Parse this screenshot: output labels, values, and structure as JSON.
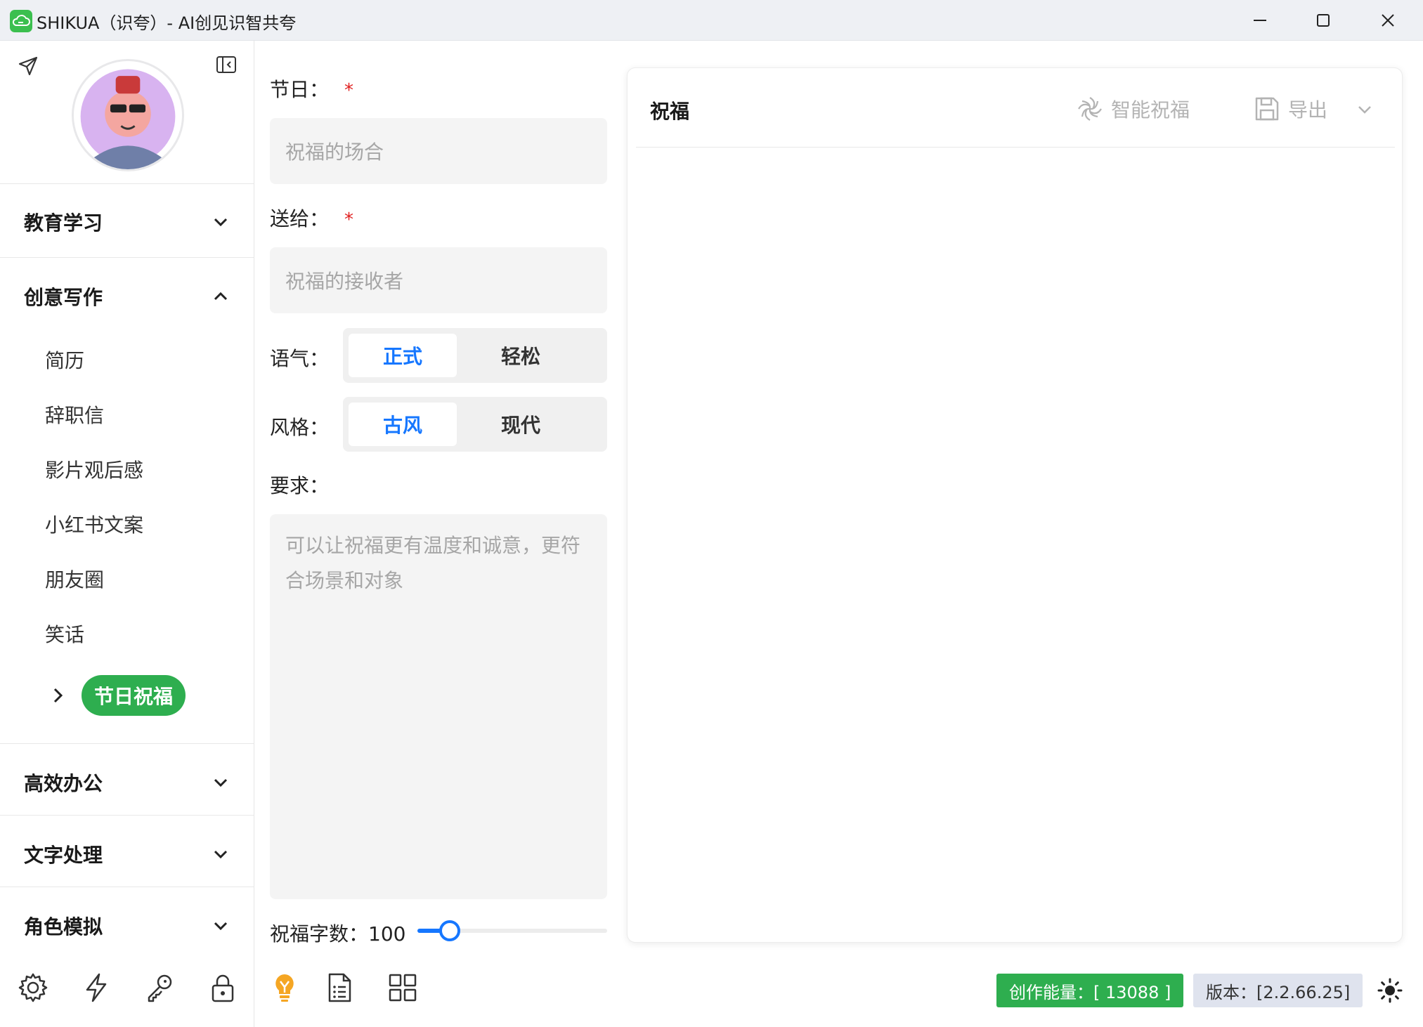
{
  "window": {
    "title": "SHIKUA（识夸）- AI创见识智共夸",
    "icons": {
      "app": "cloud-logo-icon",
      "minimize": "minimize-icon",
      "maximize": "maximize-icon",
      "close": "close-icon"
    }
  },
  "sidebar": {
    "categories": [
      {
        "label": "教育学习",
        "expanded": false
      },
      {
        "label": "创意写作",
        "expanded": true
      },
      {
        "label": "高效办公",
        "expanded": false
      },
      {
        "label": "文字处理",
        "expanded": false
      },
      {
        "label": "角色模拟",
        "expanded": false
      }
    ],
    "creative_items": [
      "简历",
      "辞职信",
      "影片观后感",
      "小红书文案",
      "朋友圈",
      "笑话"
    ],
    "active_item": "节日祝福",
    "bottom_icons": [
      "settings-icon",
      "lightning-icon",
      "key-icon",
      "lock-icon"
    ]
  },
  "form": {
    "holiday": {
      "label": "节日：",
      "required_mark": "*",
      "placeholder": "祝福的场合"
    },
    "recipient": {
      "label": "送给：",
      "required_mark": "*",
      "placeholder": "祝福的接收者"
    },
    "tone": {
      "label": "语气：",
      "options": [
        "正式",
        "轻松"
      ],
      "selected": "正式"
    },
    "style": {
      "label": "风格：",
      "options": [
        "古风",
        "现代"
      ],
      "selected": "古风"
    },
    "requirements": {
      "label": "要求：",
      "placeholder": "可以让祝福更有温度和诚意，更符合场景和对象"
    },
    "word_count": {
      "label": "祝福字数：",
      "value": "100",
      "fraction": 0.08
    },
    "bottom_icons": [
      "lightbulb-icon",
      "document-list-icon",
      "grid-icon"
    ]
  },
  "output": {
    "title": "祝福",
    "smart_button": "智能祝福",
    "export_button": "导出"
  },
  "status": {
    "energy": "创作能量：[ 13088 ]",
    "version": "版本：[2.2.66.25]"
  },
  "colors": {
    "accent_green": "#2eae4f",
    "accent_blue": "#1677ff",
    "required_red": "#e02020"
  }
}
